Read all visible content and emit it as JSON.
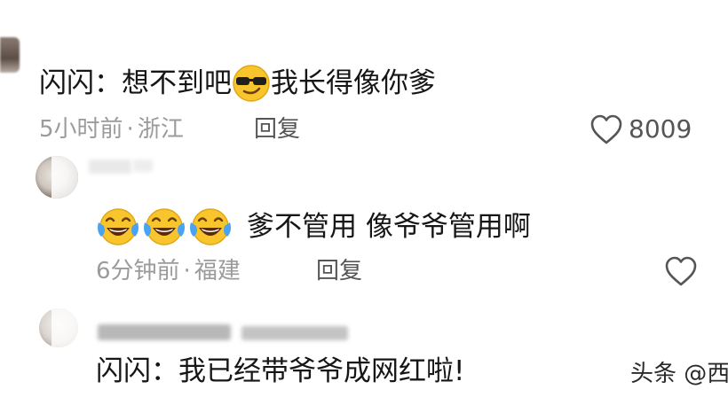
{
  "comments": [
    {
      "text_before_emoji": "闪闪：想不到吧",
      "emoji": "sunglasses-emoji",
      "text_after_emoji": "我长得像你爹",
      "time": "5小时前",
      "separator": "·",
      "location": "浙江",
      "reply_label": "回复",
      "likes": "8009"
    },
    {
      "emojis": [
        "laughing-tears-emoji",
        "laughing-tears-emoji",
        "laughing-tears-emoji"
      ],
      "text": "爹不管用 像爷爷管用啊",
      "time": "6分钟前",
      "separator": "·",
      "location": "福建",
      "reply_label": "回复"
    },
    {
      "text": "闪闪：我已经带爷爷成网红啦!"
    }
  ],
  "watermark": "头条 @西",
  "colors": {
    "text": "#161616",
    "meta": "#9b9b9b",
    "reply": "#555555",
    "emoji_yellow": "#f8c52c",
    "tears_blue": "#4aa3f0"
  }
}
